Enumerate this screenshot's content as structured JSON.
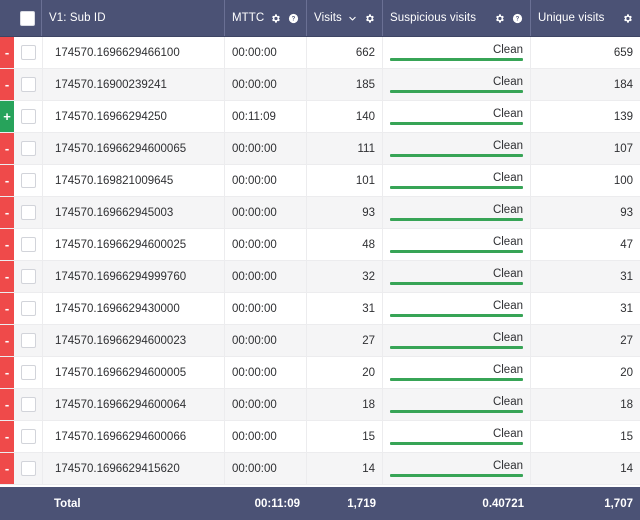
{
  "table": {
    "columns": [
      {
        "key": "flag",
        "label": "",
        "icons": []
      },
      {
        "key": "check",
        "label": "",
        "icons": [
          "checkbox-icon"
        ]
      },
      {
        "key": "subid",
        "label": "V1: Sub ID",
        "icons": []
      },
      {
        "key": "mttc",
        "label": "MTTC",
        "icons": [
          "gear-icon",
          "help-icon"
        ]
      },
      {
        "key": "visits",
        "label": "Visits",
        "icons": [
          "chevron-down-icon",
          "gear-icon"
        ]
      },
      {
        "key": "susp",
        "label": "Suspicious visits",
        "icons": [
          "gear-icon",
          "help-icon"
        ]
      },
      {
        "key": "uniq",
        "label": "Unique visits",
        "icons": [
          "gear-icon"
        ]
      }
    ],
    "header": {
      "subid": "V1: Sub ID",
      "mttc": "MTTC",
      "visits": "Visits",
      "suspicious": "Suspicious visits",
      "unique": "Unique visits"
    },
    "rows": [
      {
        "flag": "-",
        "flag_state": "negative",
        "sub_id": "174570.1696629466100",
        "mttc": "00:00:00",
        "visits": "662",
        "suspicious_label": "Clean",
        "suspicious_bar_pct": 100,
        "unique": "659"
      },
      {
        "flag": "-",
        "flag_state": "negative",
        "sub_id": "174570.16900239241",
        "mttc": "00:00:00",
        "visits": "185",
        "suspicious_label": "Clean",
        "suspicious_bar_pct": 100,
        "unique": "184"
      },
      {
        "flag": "+",
        "flag_state": "positive",
        "sub_id": "174570.16966294250",
        "mttc": "00:11:09",
        "visits": "140",
        "suspicious_label": "Clean",
        "suspicious_bar_pct": 100,
        "unique": "139"
      },
      {
        "flag": "-",
        "flag_state": "negative",
        "sub_id": "174570.16966294600065",
        "mttc": "00:00:00",
        "visits": "111",
        "suspicious_label": "Clean",
        "suspicious_bar_pct": 100,
        "unique": "107"
      },
      {
        "flag": "-",
        "flag_state": "negative",
        "sub_id": "174570.169821009645",
        "mttc": "00:00:00",
        "visits": "101",
        "suspicious_label": "Clean",
        "suspicious_bar_pct": 100,
        "unique": "100"
      },
      {
        "flag": "-",
        "flag_state": "negative",
        "sub_id": "174570.169662945003",
        "mttc": "00:00:00",
        "visits": "93",
        "suspicious_label": "Clean",
        "suspicious_bar_pct": 100,
        "unique": "93"
      },
      {
        "flag": "-",
        "flag_state": "negative",
        "sub_id": "174570.16966294600025",
        "mttc": "00:00:00",
        "visits": "48",
        "suspicious_label": "Clean",
        "suspicious_bar_pct": 100,
        "unique": "47"
      },
      {
        "flag": "-",
        "flag_state": "negative",
        "sub_id": "174570.16966294999760",
        "mttc": "00:00:00",
        "visits": "32",
        "suspicious_label": "Clean",
        "suspicious_bar_pct": 100,
        "unique": "31"
      },
      {
        "flag": "-",
        "flag_state": "negative",
        "sub_id": "174570.1696629430000",
        "mttc": "00:00:00",
        "visits": "31",
        "suspicious_label": "Clean",
        "suspicious_bar_pct": 100,
        "unique": "31"
      },
      {
        "flag": "-",
        "flag_state": "negative",
        "sub_id": "174570.16966294600023",
        "mttc": "00:00:00",
        "visits": "27",
        "suspicious_label": "Clean",
        "suspicious_bar_pct": 100,
        "unique": "27"
      },
      {
        "flag": "-",
        "flag_state": "negative",
        "sub_id": "174570.16966294600005",
        "mttc": "00:00:00",
        "visits": "20",
        "suspicious_label": "Clean",
        "suspicious_bar_pct": 100,
        "unique": "20"
      },
      {
        "flag": "-",
        "flag_state": "negative",
        "sub_id": "174570.16966294600064",
        "mttc": "00:00:00",
        "visits": "18",
        "suspicious_label": "Clean",
        "suspicious_bar_pct": 100,
        "unique": "18"
      },
      {
        "flag": "-",
        "flag_state": "negative",
        "sub_id": "174570.16966294600066",
        "mttc": "00:00:00",
        "visits": "15",
        "suspicious_label": "Clean",
        "suspicious_bar_pct": 100,
        "unique": "15"
      },
      {
        "flag": "-",
        "flag_state": "negative",
        "sub_id": "174570.1696629415620",
        "mttc": "00:00:00",
        "visits": "14",
        "suspicious_label": "Clean",
        "suspicious_bar_pct": 100,
        "unique": "14"
      }
    ],
    "total": {
      "label": "Total",
      "mttc": "00:11:09",
      "visits": "1,719",
      "suspicious": "0.40721",
      "unique": "1,707"
    }
  },
  "colors": {
    "header_bg": "#4b5275",
    "total_bg": "#4b5275",
    "flag_negative": "#ef4a4a",
    "flag_positive": "#27a35b",
    "bar_green": "#37a456",
    "row_alt_bg": "#f5f5f6",
    "text": "#2f3033"
  }
}
